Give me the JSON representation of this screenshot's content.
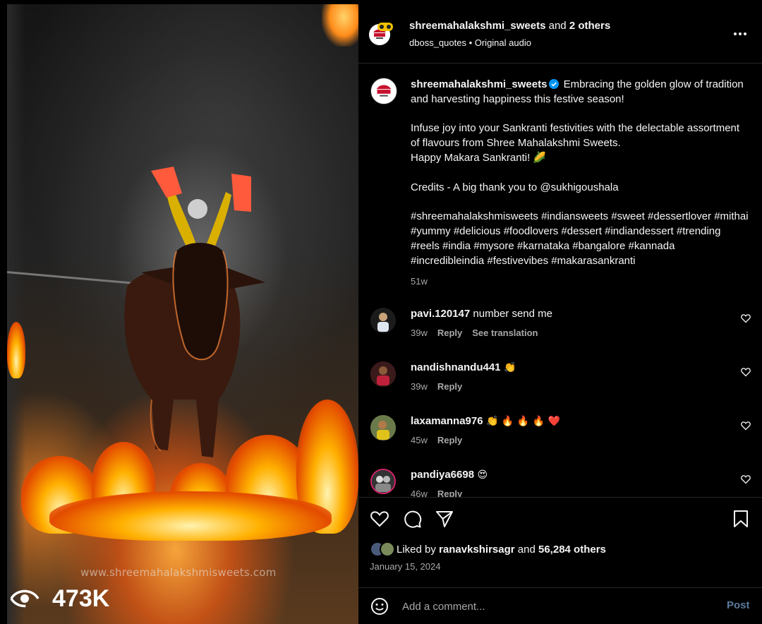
{
  "media": {
    "watermark": "www.shreemahalakshmisweets.com",
    "views": "473K",
    "icons": {
      "views": "eye-play-icon"
    }
  },
  "header": {
    "username": "shreemahalakshmi_sweets",
    "and_text": " and ",
    "others": "2 others",
    "audio_user": "dboss_quotes",
    "separator": " • ",
    "audio": "Original audio",
    "icons": {
      "more": "more-horizontal-icon"
    }
  },
  "caption": {
    "username": "shreemahalakshmi_sweets",
    "text": " Embracing the golden glow of tradition and harvesting happiness this festive season!\n\nInfuse joy into your Sankranti festivities with the delectable assortment of flavours from Shree Mahalakshmi Sweets.\nHappy Makara Sankranti! 🌽\n\nCredits - A big thank you to @sukhigoushala\n\n#shreemahalakshmisweets #indiansweets #sweet #dessertlover #mithai #yummy #delicious #foodlovers #dessert #indiandessert #trending #reels #india #mysore #karnataka #bangalore #kannada #incredibleindia #festivevibes #makarasankranti",
    "time": "51w"
  },
  "comments": [
    {
      "user": "pavi.120147",
      "text": " number send me",
      "time": "39w",
      "reply": "Reply",
      "translate": "See translation"
    },
    {
      "user": "nandishnandu441",
      "text": " 👏",
      "time": "39w",
      "reply": "Reply"
    },
    {
      "user": "laxamanna976",
      "text": " 👏 🔥 🔥 🔥 ❤️",
      "time": "45w",
      "reply": "Reply"
    },
    {
      "user": "pandiya6698",
      "text": " 😍",
      "time": "46w",
      "reply": "Reply"
    }
  ],
  "actions": {
    "icons": [
      "heart-icon",
      "comment-icon",
      "share-icon",
      "bookmark-icon"
    ],
    "liked_prefix": "Liked by ",
    "liked_user": "ranavkshirsagr",
    "liked_and": " and ",
    "liked_others": "56,284 others",
    "date": "January 15, 2024"
  },
  "add_comment": {
    "placeholder": "Add a comment...",
    "post": "Post",
    "icons": {
      "emoji": "emoji-icon"
    }
  },
  "colors": {
    "background": "#000000",
    "text": "#f5f5f5",
    "secondary_text": "#a8a8a8",
    "verified": "#0095f6",
    "post_disabled": "#5a7b9c",
    "divider": "#262626"
  }
}
